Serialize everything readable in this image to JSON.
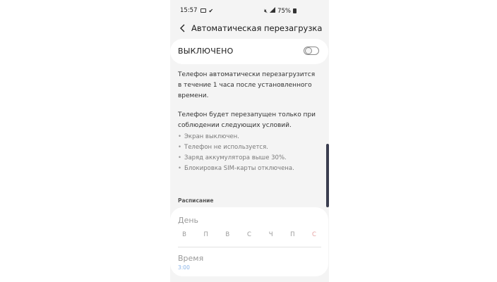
{
  "statusbar": {
    "time": "15:57",
    "battery": "75%"
  },
  "appbar": {
    "title": "Автоматическая перезагрузка",
    "back_icon": "chevron-left-icon"
  },
  "toggle": {
    "label": "ВЫКЛЮЧЕНО",
    "state": "off"
  },
  "description": {
    "paragraph1": "Телефон автоматически перезагрузится в течение 1 часа после установленного времени.",
    "paragraph2": "Телефон будет перезапущен только при соблюдении следующих условий.",
    "conditions": [
      "Экран выключен.",
      "Телефон не используется.",
      "Заряд аккумулятора выше 30%.",
      "Блокировка SIM-карты отключена."
    ]
  },
  "schedule": {
    "header": "Расписание",
    "day_label": "День",
    "days": [
      "В",
      "П",
      "В",
      "С",
      "Ч",
      "П",
      "С"
    ],
    "time_label": "Время",
    "time_value": "3:00"
  },
  "colors": {
    "background": "#f4f4f4",
    "card": "#ffffff",
    "accent_time": "#8ab4e8",
    "sunday": "#e6a3a3",
    "scroll_indicator": "#3a3d4f"
  }
}
